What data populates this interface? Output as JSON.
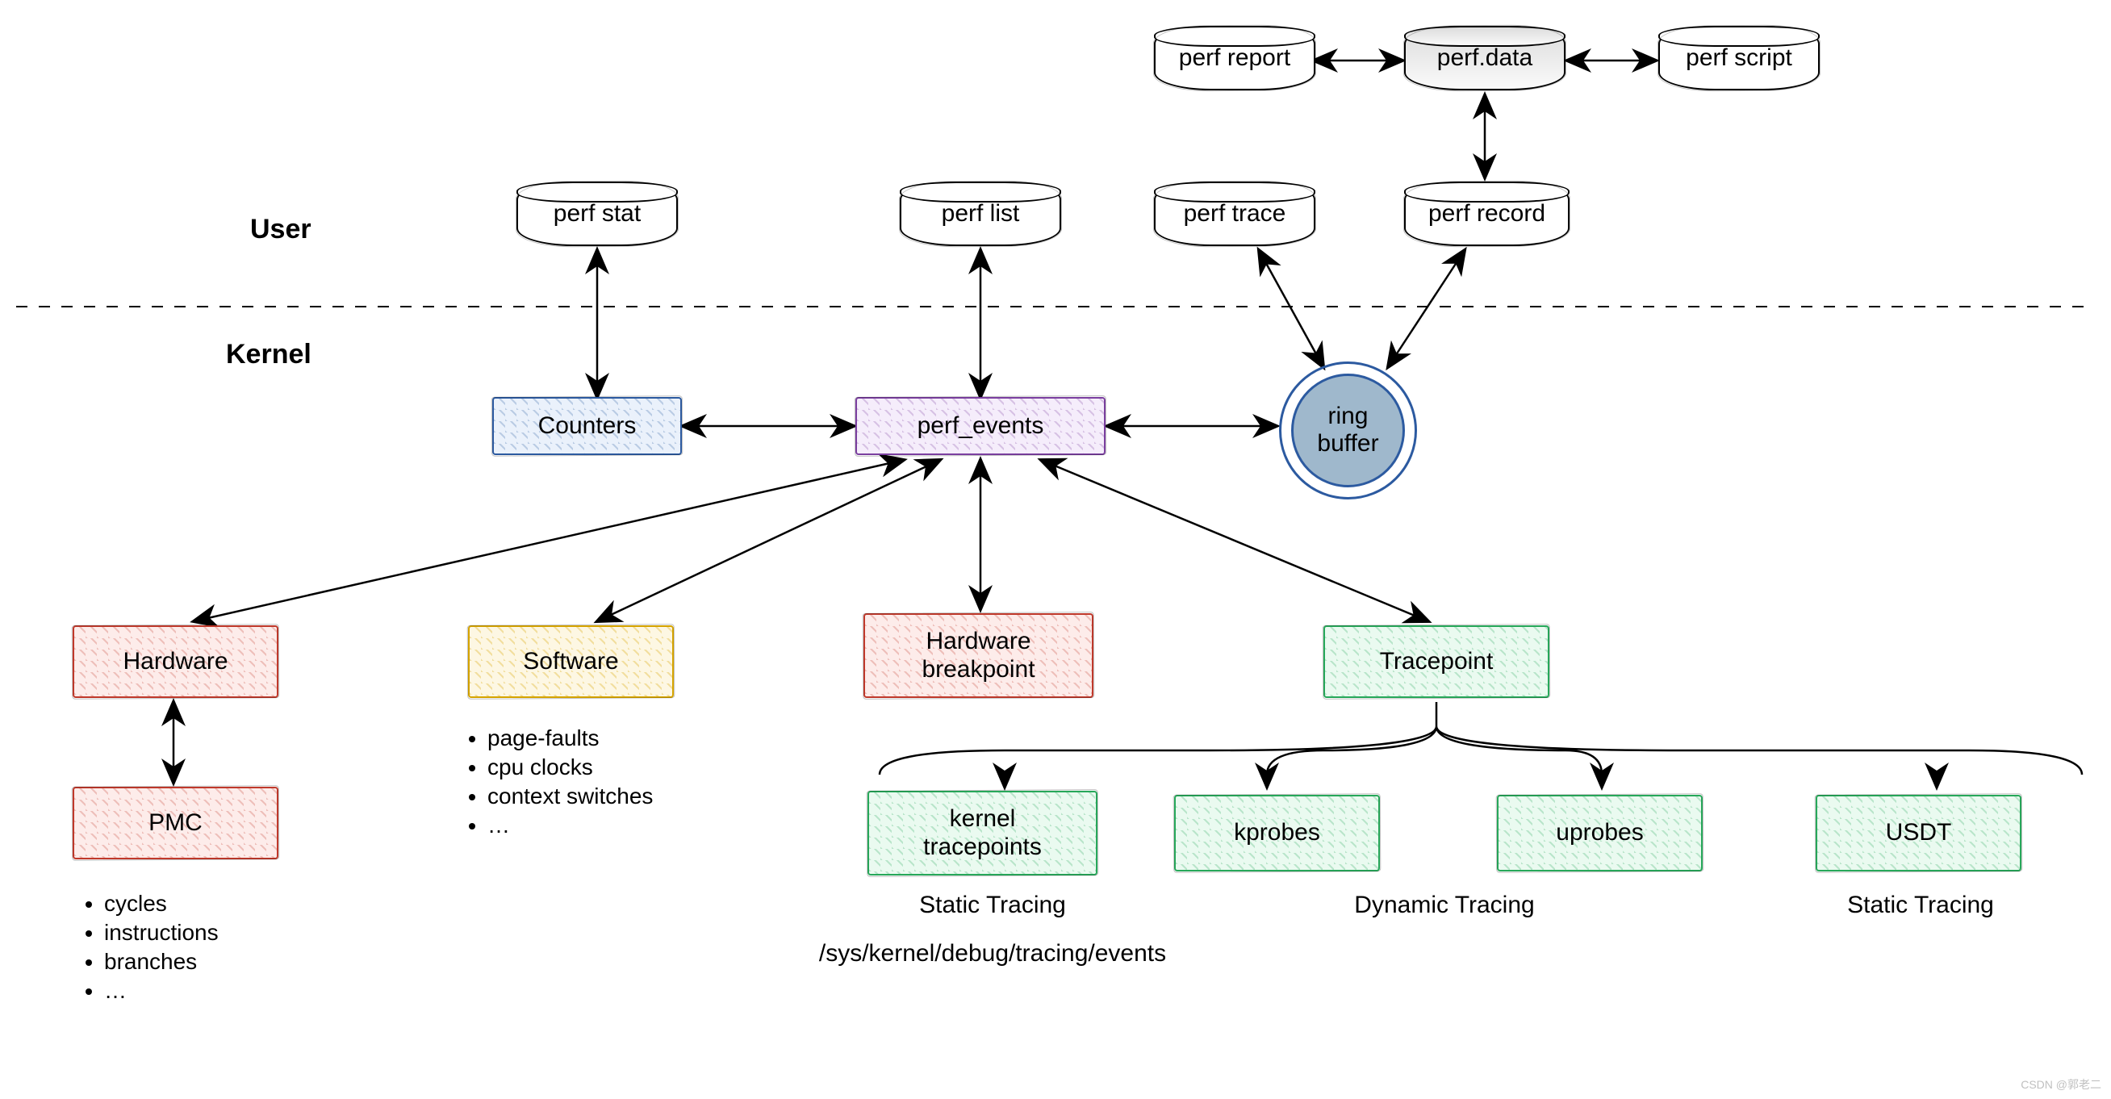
{
  "labels": {
    "user": "User",
    "kernel": "Kernel"
  },
  "disks": {
    "perf_stat": "perf stat",
    "perf_list": "perf list",
    "perf_trace": "perf trace",
    "perf_record": "perf record",
    "perf_report": "perf report",
    "perf_data": "perf.data",
    "perf_script": "perf script"
  },
  "kernel_boxes": {
    "counters": "Counters",
    "perf_events": "perf_events"
  },
  "ring_buffer": "ring\nbuffer",
  "event_sources": {
    "hardware": "Hardware",
    "software": "Software",
    "hw_breakpoint": "Hardware\nbreakpoint",
    "tracepoint": "Tracepoint",
    "pmc": "PMC",
    "kernel_tracepoints": "kernel\ntracepoints",
    "kprobes": "kprobes",
    "uprobes": "uprobes",
    "usdt": "USDT"
  },
  "bullet_lists": {
    "software": [
      "page-faults",
      "cpu clocks",
      "context switches",
      "…"
    ],
    "pmc": [
      "cycles",
      "instructions",
      "branches",
      "…"
    ]
  },
  "captions": {
    "static_tracing_1": "Static Tracing",
    "dynamic_tracing": "Dynamic Tracing",
    "static_tracing_2": "Static Tracing",
    "sysfs_path": "/sys/kernel/debug/tracing/events"
  },
  "watermark": "CSDN @郭老二"
}
